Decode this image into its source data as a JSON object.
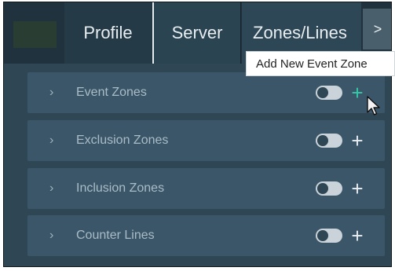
{
  "tabs": [
    {
      "label": "Profile"
    },
    {
      "label": "Server"
    },
    {
      "label": "Zones/Lines"
    }
  ],
  "tab_scroll_label": ">",
  "tooltip": "Add New Event Zone",
  "zones": [
    {
      "label": "Event Zones",
      "enabled": true,
      "add_label": "+"
    },
    {
      "label": "Exclusion Zones",
      "enabled": true,
      "add_label": "+"
    },
    {
      "label": "Inclusion Zones",
      "enabled": true,
      "add_label": "+"
    },
    {
      "label": "Counter Lines",
      "enabled": true,
      "add_label": "+"
    }
  ],
  "colors": {
    "panel_bg": "#2f4655",
    "row_bg": "#3b5668",
    "accent_hover": "#33c9a8"
  }
}
